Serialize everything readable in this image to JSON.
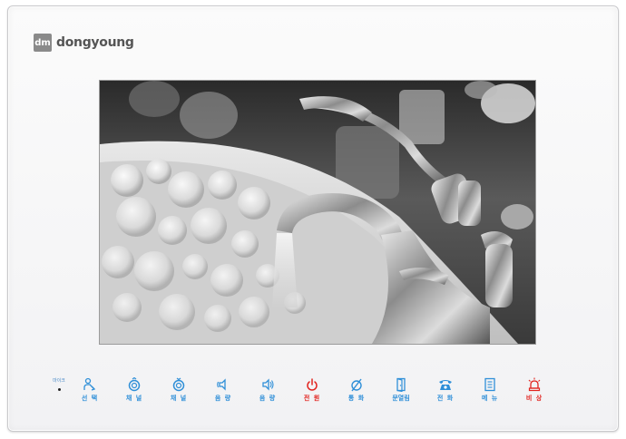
{
  "brand": {
    "mark": "dm",
    "name": "dongyoung"
  },
  "mic": {
    "label": "마이크"
  },
  "buttons": [
    {
      "label": "선 택",
      "icon": "user-select-icon",
      "color": "#2f8fd8"
    },
    {
      "label": "채 널",
      "icon": "channel-up-icon",
      "color": "#2f8fd8"
    },
    {
      "label": "채 널",
      "icon": "channel-down-icon",
      "color": "#2f8fd8"
    },
    {
      "label": "음 량",
      "icon": "volume-down-icon",
      "color": "#2f8fd8"
    },
    {
      "label": "음 량",
      "icon": "volume-up-icon",
      "color": "#2f8fd8"
    },
    {
      "label": "전 원",
      "icon": "power-icon",
      "color": "#e2241f"
    },
    {
      "label": "통 화",
      "icon": "call-icon",
      "color": "#2f8fd8"
    },
    {
      "label": "문열림",
      "icon": "door-open-icon",
      "color": "#2f8fd8"
    },
    {
      "label": "전 화",
      "icon": "telephone-icon",
      "color": "#2f8fd8"
    },
    {
      "label": "메 뉴",
      "icon": "menu-icon",
      "color": "#2f8fd8"
    },
    {
      "label": "비 상",
      "icon": "emergency-siren-icon",
      "color": "#e2241f"
    }
  ]
}
